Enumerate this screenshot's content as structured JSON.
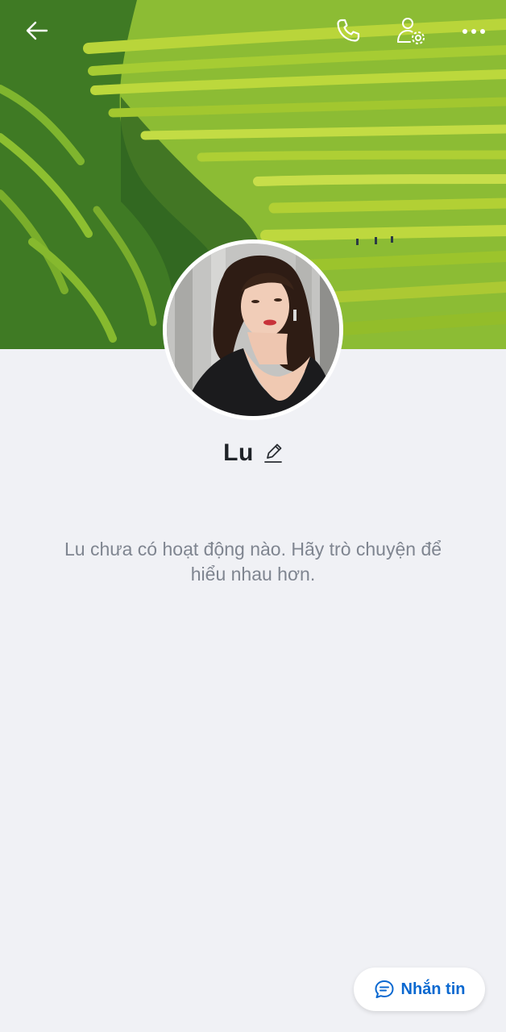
{
  "profile": {
    "name": "Lu",
    "empty_message": "Lu chưa có hoạt động nào. Hãy trò chuyện để hiểu nhau hơn."
  },
  "actions": {
    "chat_label": "Nhắn tin"
  },
  "icons": {
    "back": "arrow-left-icon",
    "call": "phone-icon",
    "profile_settings": "user-settings-icon",
    "more": "more-dots-icon",
    "edit": "pencil-icon",
    "chat": "chat-bubble-icon"
  },
  "colors": {
    "accent": "#0a68d0",
    "background": "#f0f1f5",
    "name_text": "#1f2328",
    "muted_text": "#7f8590"
  }
}
